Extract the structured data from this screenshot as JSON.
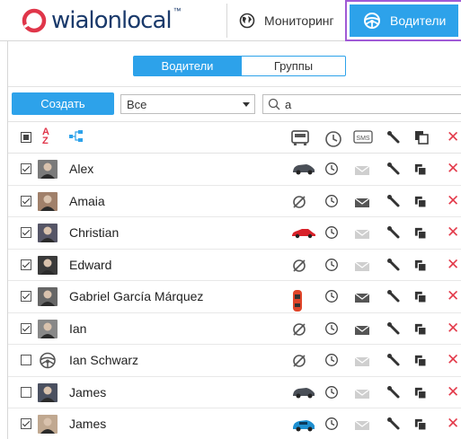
{
  "header": {
    "logo_text": "wialon",
    "logo_text_2": "local",
    "logo_mark": "™",
    "nav_monitoring": "Мониторинг",
    "nav_drivers": "Водители",
    "brand_color": "#2da2ea",
    "highlight_color": "#a05ad6"
  },
  "tabs": [
    {
      "label": "Водители",
      "active": true
    },
    {
      "label": "Группы",
      "active": false
    }
  ],
  "toolbar": {
    "create_label": "Создать",
    "filter_value": "Все",
    "search_value": "а",
    "clear_symbol": "×"
  },
  "grid": {
    "header_icons": [
      "select-all-checkbox",
      "sort-az-icon",
      "group-tree-icon",
      "unit-icon",
      "history-clock-icon",
      "sms-icon",
      "properties-wrench-icon",
      "copy-icon",
      "delete-icon"
    ],
    "rows": [
      {
        "name": "Alex",
        "checked": true,
        "unit": "car-dark",
        "sms": false
      },
      {
        "name": "Amaia",
        "checked": true,
        "unit": "none",
        "sms": true
      },
      {
        "name": "Christian",
        "checked": true,
        "unit": "car-red",
        "sms": false
      },
      {
        "name": "Edward",
        "checked": true,
        "unit": "none",
        "sms": false
      },
      {
        "name": "Gabriel García Márquez",
        "checked": true,
        "unit": "car-top-red",
        "sms": true
      },
      {
        "name": "Ian",
        "checked": true,
        "unit": "none",
        "sms": true
      },
      {
        "name": "Ian Schwarz",
        "checked": false,
        "unit": "none",
        "sms": false
      },
      {
        "name": "James",
        "checked": false,
        "unit": "car-dark",
        "sms": false
      },
      {
        "name": "James",
        "checked": true,
        "unit": "car-blue",
        "sms": false
      }
    ]
  }
}
